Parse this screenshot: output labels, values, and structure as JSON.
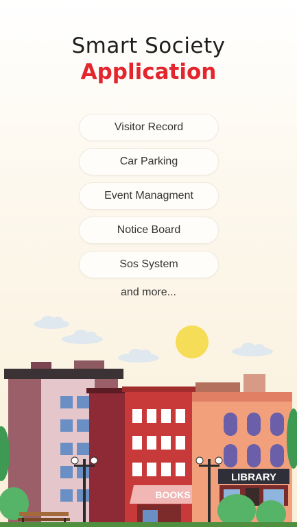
{
  "header": {
    "title_line1": "Smart Society",
    "title_line2": "Application"
  },
  "features": [
    {
      "label": "Visitor Record"
    },
    {
      "label": "Car Parking"
    },
    {
      "label": "Event Managment"
    },
    {
      "label": "Notice Board"
    },
    {
      "label": "Sos System"
    }
  ],
  "more_text": "and more...",
  "illustration": {
    "signs": {
      "books": "BOOKS",
      "library": "LIBRARY"
    }
  },
  "colors": {
    "accent": "#e3262d",
    "sun": "#f6dd57"
  }
}
